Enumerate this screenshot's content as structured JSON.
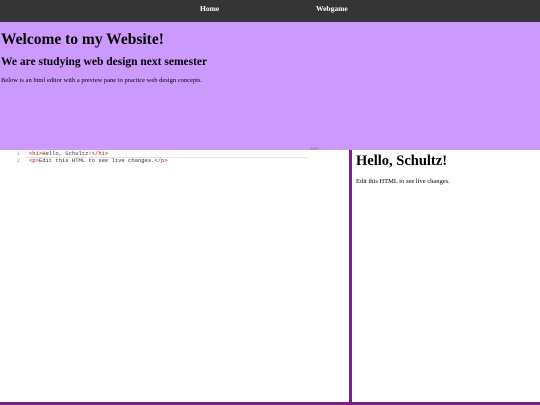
{
  "nav": {
    "home_label": "Home",
    "webgame_label": "Webgame"
  },
  "hero": {
    "title": "Welcome to my Website!",
    "subtitle": "We are studying web design next semester",
    "description": "Below is an html editor with a preview pane to practice web design concepts."
  },
  "editor": {
    "lines": [
      {
        "number": "1",
        "open_tag": "<h1>",
        "text": "Hello, Schultz!",
        "close_tag": "</h1>"
      },
      {
        "number": "2",
        "open_tag": "<p>",
        "text": "Edit this HTML to see live changes.",
        "close_tag": "</p>"
      }
    ],
    "overflow_stub": "ses"
  },
  "preview": {
    "heading": "Hello, Schultz!",
    "paragraph": "Edit this HTML to see live changes."
  },
  "colors": {
    "nav_bg": "#353535",
    "hero_bg": "#cc99ff",
    "accent_border": "#7a1f8a",
    "tag_color": "#aa1111"
  }
}
